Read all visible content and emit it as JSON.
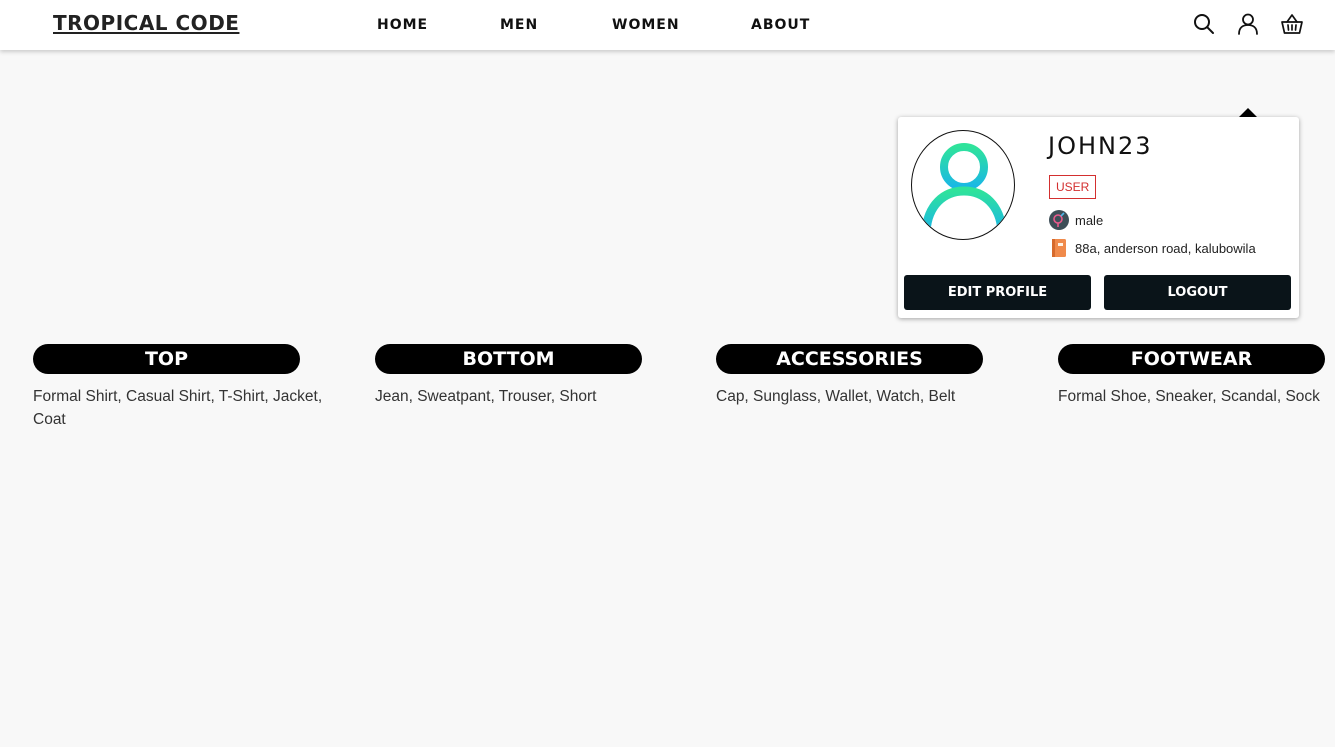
{
  "header": {
    "logo": "TROPICAL CODE",
    "nav": [
      "HOME",
      "MEN",
      "WOMEN",
      "ABOUT"
    ],
    "icons": [
      "search-icon",
      "user-icon",
      "cart-icon"
    ]
  },
  "profile": {
    "username": "JOHN23",
    "role": "USER",
    "gender": "male",
    "address": "88a, anderson road, kalubowila",
    "edit_label": "EDIT PROFILE",
    "logout_label": "LOGOUT",
    "colors": {
      "badge": "#d32f2f",
      "button": "#0a1419",
      "avatar_gradient": [
        "#2fe39b",
        "#1ab7e6"
      ]
    }
  },
  "categories": [
    {
      "title": "TOP",
      "items": "Formal Shirt, Casual Shirt, T-Shirt, Jacket, Coat"
    },
    {
      "title": "BOTTOM",
      "items": "Jean, Sweatpant, Trouser, Short"
    },
    {
      "title": "ACCESSORIES",
      "items": "Cap, Sunglass, Wallet, Watch, Belt"
    },
    {
      "title": "FOOTWEAR",
      "items": "Formal Shoe, Sneaker, Scandal, Sock"
    }
  ]
}
